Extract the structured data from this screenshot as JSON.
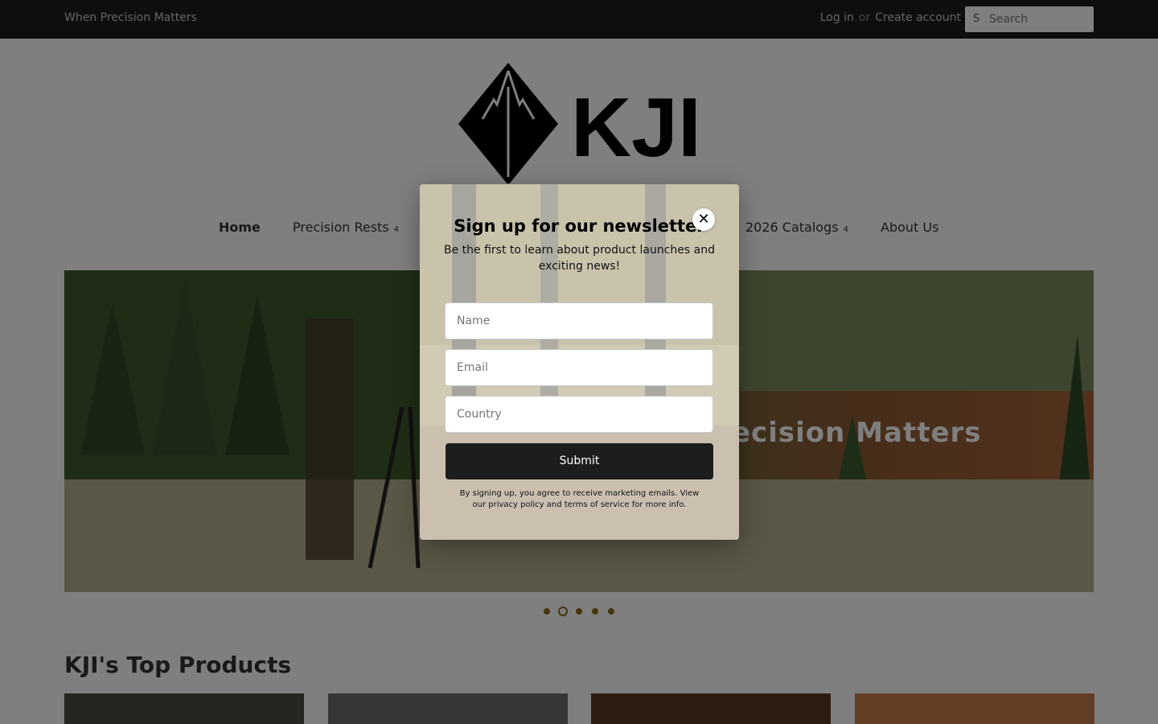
{
  "header": {
    "tagline": "When Precision Matters",
    "login": "Log in",
    "or": "or",
    "create_account": "Create account",
    "search_placeholder": "Search",
    "search_icon": "S"
  },
  "logo": {
    "text": "KJI"
  },
  "nav": {
    "items": [
      {
        "label": "Home",
        "active": true,
        "caret": ""
      },
      {
        "label": "Precision Rests",
        "caret": "4"
      },
      {
        "label": "2026 Catalogs",
        "caret": "4"
      },
      {
        "label": "About Us",
        "caret": ""
      }
    ]
  },
  "hero": {
    "title": "ecision Matters"
  },
  "slider": {
    "prev": "",
    "next": "",
    "edge": "",
    "dots": 5,
    "active": 2
  },
  "section": {
    "title": "KJI's Top Products"
  },
  "popup": {
    "title": "Sign up for our newsletter",
    "subtitle": "Be the first to learn about product launches and exciting news!",
    "close": "✕",
    "name_placeholder": "Name",
    "email_placeholder": "Email",
    "country_placeholder": "Country",
    "submit": "Submit",
    "disclaimer": "By signing up, you agree to receive marketing emails. View our privacy policy and terms of service for more info."
  },
  "colors": {
    "topbar": "#1c1d1d",
    "accent": "#8a6d1a",
    "button": "#1d1d1d"
  }
}
